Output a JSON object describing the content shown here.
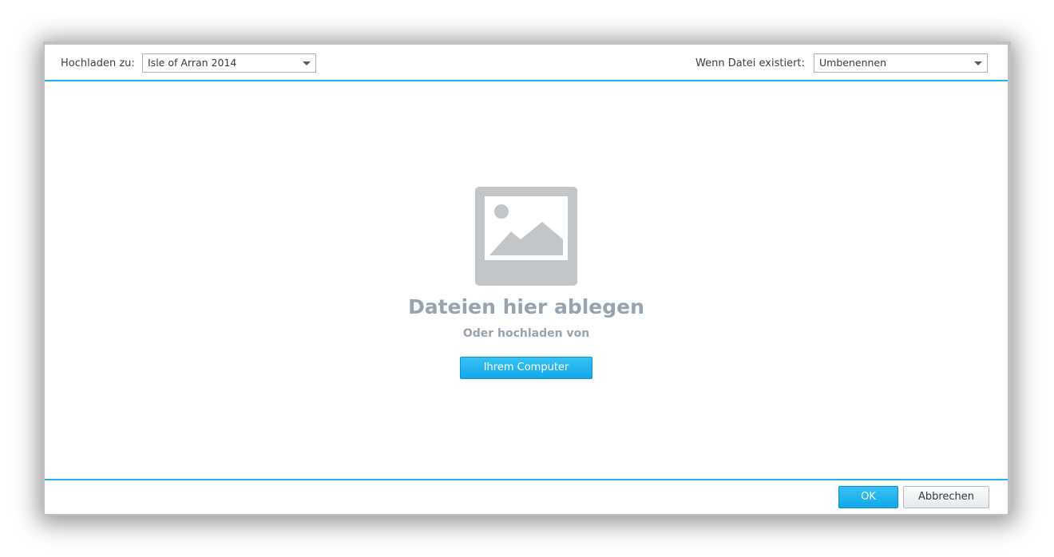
{
  "toolbar": {
    "upload_to_label": "Hochladen zu:",
    "upload_to_value": "Isle of Arran 2014",
    "if_exists_label": "Wenn Datei existiert:",
    "if_exists_value": "Umbenennen"
  },
  "dropzone": {
    "icon": "image-placeholder-icon",
    "title": "Dateien hier ablegen",
    "subtitle": "Oder hochladen von",
    "computer_button_label": "Ihrem Computer"
  },
  "footer": {
    "ok_label": "OK",
    "cancel_label": "Abbrechen"
  },
  "colors": {
    "accent": "#20b3f0",
    "button_primary": "#13a7e8",
    "placeholder_text": "#97a3ae",
    "placeholder_icon": "#c3c6c8"
  }
}
